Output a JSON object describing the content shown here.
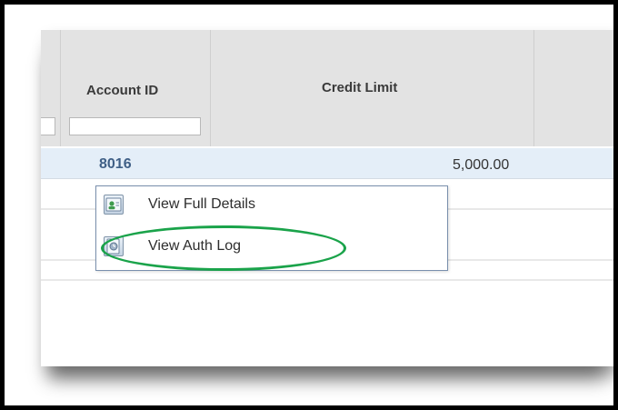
{
  "grid": {
    "columns": [
      {
        "label": ""
      },
      {
        "label": "Account ID"
      },
      {
        "label": "Credit Limit"
      }
    ],
    "rows": [
      {
        "account_id": "8016",
        "credit_limit": "5,000.00"
      }
    ]
  },
  "context_menu": {
    "items": [
      {
        "label": "View Full Details",
        "icon": "user-card-icon"
      },
      {
        "label": "View Auth Log",
        "icon": "log-document-icon"
      }
    ]
  },
  "annotation": {
    "color": "#1aa34a"
  }
}
